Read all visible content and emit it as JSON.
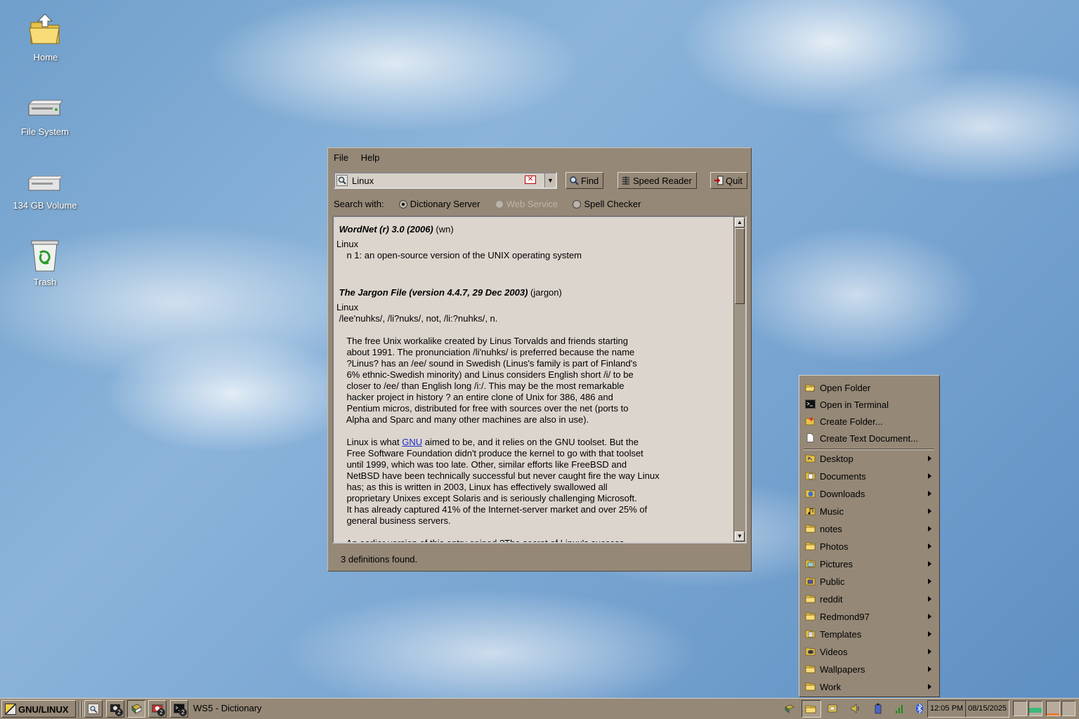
{
  "desktop": {
    "icons": [
      {
        "label": "Home"
      },
      {
        "label": "File System"
      },
      {
        "label": "134 GB Volume"
      },
      {
        "label": "Trash"
      }
    ]
  },
  "dictionary": {
    "menu": [
      "File",
      "Help"
    ],
    "search_value": "Linux",
    "buttons": {
      "find": "Find",
      "speed_reader": "Speed Reader",
      "quit": "Quit"
    },
    "search_with_label": "Search with:",
    "sources": [
      {
        "label": "Dictionary Server",
        "selected": true,
        "enabled": true
      },
      {
        "label": "Web Service",
        "selected": false,
        "enabled": false
      },
      {
        "label": "Spell Checker",
        "selected": false,
        "enabled": true
      }
    ],
    "definitions": [
      {
        "source": "WordNet (r) 3.0 (2006)",
        "code": "(wn)",
        "word": "Linux",
        "lines": [
          "    n 1: an open-source version of the UNIX operating system"
        ]
      },
      {
        "source": "The Jargon File (version 4.4.7, 29 Dec 2003)",
        "code": "(jargon)",
        "word": "Linux",
        "pronunciation": " /lee'nuhks/, /li?nuks/, not, /li:?nuhks/, n.",
        "paragraph1": [
          "    The free Unix workalike created by Linus Torvalds and friends starting",
          "    about 1991. The pronunciation /li'nuhks/ is preferred because the name",
          "    ?Linus? has an /ee/ sound in Swedish (Linus's family is part of Finland's",
          "    6% ethnic-Swedish minority) and Linus considers English short /i/ to be",
          "    closer to /ee/ than English long /i:/. This may be the most remarkable",
          "    hacker project in history ? an entire clone of Unix for 386, 486 and",
          "    Pentium micros, distributed for free with sources over the net (ports to",
          "    Alpha and Sparc and many other machines are also in use)."
        ],
        "p2_before_link": "    Linux is what ",
        "p2_link": "GNU",
        "p2_after_link": " aimed to be, and it relies on the GNU toolset. But the",
        "paragraph2": [
          "    Free Software Foundation didn't produce the kernel to go with that toolset",
          "    until 1999, which was too late. Other, similar efforts like FreeBSD and",
          "    NetBSD have been technically successful but never caught fire the way Linux",
          "    has; as this is written in 2003, Linux has effectively swallowed all",
          "    proprietary Unixes except Solaris and is seriously challenging Microsoft.",
          "    It has already captured 41% of the Internet-server market and over 25% of",
          "    general business servers."
        ],
        "paragraph3_partial": "    An earlier version of this entry opined ?The secret of Linux's success"
      }
    ],
    "status": "3 definitions found."
  },
  "context_menu": {
    "actions": [
      {
        "label": "Open Folder",
        "icon": "open-folder-icon"
      },
      {
        "label": "Open in Terminal",
        "icon": "terminal-icon"
      },
      {
        "label": "Create Folder...",
        "icon": "new-folder-icon"
      },
      {
        "label": "Create Text Document...",
        "icon": "text-document-icon"
      }
    ],
    "folders": [
      {
        "label": "Desktop",
        "icon": "desktop-folder-icon"
      },
      {
        "label": "Documents",
        "icon": "documents-folder-icon"
      },
      {
        "label": "Downloads",
        "icon": "downloads-folder-icon"
      },
      {
        "label": "Music",
        "icon": "music-folder-icon"
      },
      {
        "label": "notes",
        "icon": "folder-icon"
      },
      {
        "label": "Photos",
        "icon": "folder-icon"
      },
      {
        "label": "Pictures",
        "icon": "pictures-folder-icon"
      },
      {
        "label": "Public",
        "icon": "public-folder-icon"
      },
      {
        "label": "reddit",
        "icon": "folder-icon"
      },
      {
        "label": "Redmond97",
        "icon": "folder-icon"
      },
      {
        "label": "Templates",
        "icon": "templates-folder-icon"
      },
      {
        "label": "Videos",
        "icon": "videos-folder-icon"
      },
      {
        "label": "Wallpapers",
        "icon": "folder-icon"
      },
      {
        "label": "Work",
        "icon": "folder-icon"
      }
    ]
  },
  "taskbar": {
    "start_label": "GNU/LINUX",
    "task_buttons": [
      {
        "icon": "file-manager-icon",
        "badge": ""
      },
      {
        "icon": "settings-icon",
        "badge": "2"
      },
      {
        "icon": "dictionary-icon",
        "badge": ""
      },
      {
        "icon": "app-icon",
        "badge": "2"
      },
      {
        "icon": "terminal-icon",
        "badge": "2"
      }
    ],
    "active_task": "WS5 - Dictionary",
    "time": "12:05 PM",
    "date": "08/15/2025",
    "colors": {
      "face": "#958877",
      "highlight": "#e0d8cc",
      "shadow": "#3f372f"
    }
  }
}
